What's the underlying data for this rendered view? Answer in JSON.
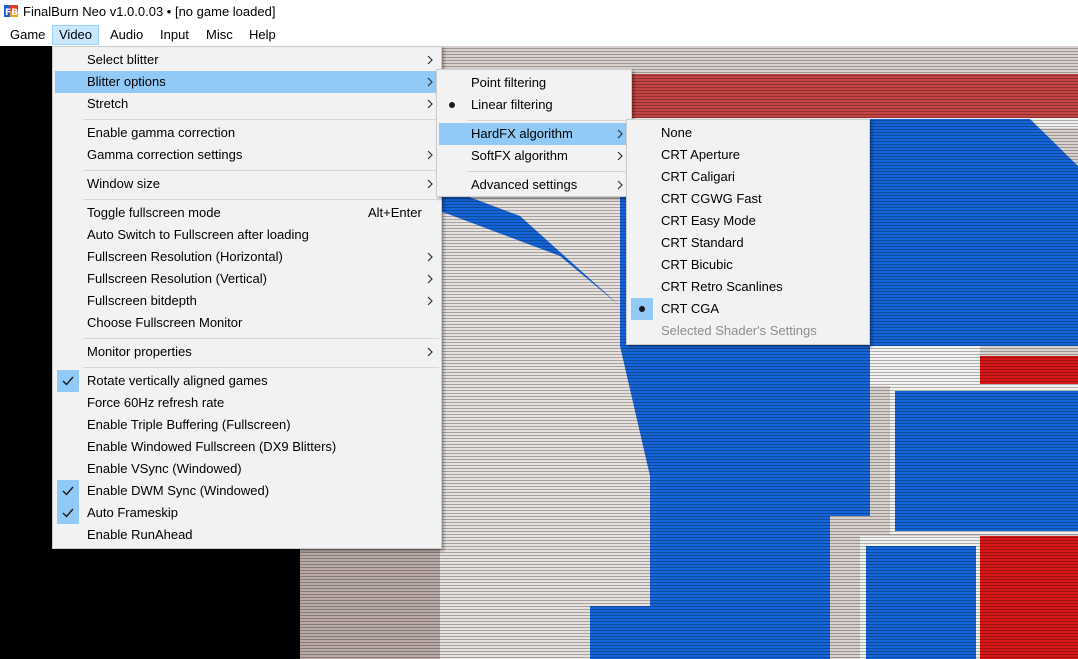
{
  "window": {
    "title": "FinalBurn Neo v1.0.0.03 • [no game loaded]",
    "icon": "fbneo-app-icon"
  },
  "menubar": {
    "items": [
      "Game",
      "Video",
      "Audio",
      "Input",
      "Misc",
      "Help"
    ],
    "active": "Video"
  },
  "video_menu": {
    "items": [
      {
        "label": "Select blitter",
        "submenu": true
      },
      {
        "label": "Blitter options",
        "submenu": true,
        "highlighted": true
      },
      {
        "label": "Stretch",
        "submenu": true
      },
      {
        "label": "Enable gamma correction"
      },
      {
        "label": "Gamma correction settings",
        "submenu": true
      },
      {
        "label": "Window size",
        "submenu": true
      },
      {
        "label": "Toggle fullscreen mode",
        "shortcut": "Alt+Enter"
      },
      {
        "label": "Auto Switch to Fullscreen after loading"
      },
      {
        "label": "Fullscreen Resolution (Horizontal)",
        "submenu": true
      },
      {
        "label": "Fullscreen Resolution (Vertical)",
        "submenu": true
      },
      {
        "label": "Fullscreen bitdepth",
        "submenu": true
      },
      {
        "label": "Choose Fullscreen Monitor"
      },
      {
        "label": "Monitor properties",
        "submenu": true
      },
      {
        "label": "Rotate vertically aligned games",
        "checked": true
      },
      {
        "label": "Force 60Hz refresh rate"
      },
      {
        "label": "Enable Triple Buffering (Fullscreen)"
      },
      {
        "label": "Enable Windowed Fullscreen (DX9 Blitters)"
      },
      {
        "label": "Enable VSync (Windowed)"
      },
      {
        "label": "Enable DWM Sync (Windowed)",
        "checked": true
      },
      {
        "label": "Auto Frameskip",
        "checked": true
      },
      {
        "label": "Enable RunAhead"
      }
    ]
  },
  "blitter_options_menu": {
    "items": [
      {
        "label": "Point filtering"
      },
      {
        "label": "Linear filtering",
        "radio": true
      },
      {
        "label": "HardFX algorithm",
        "submenu": true,
        "highlighted": true
      },
      {
        "label": "SoftFX algorithm",
        "submenu": true
      },
      {
        "label": "Advanced settings",
        "submenu": true
      }
    ]
  },
  "hardfx_menu": {
    "items": [
      {
        "label": "None"
      },
      {
        "label": "CRT Aperture"
      },
      {
        "label": "CRT Caligari"
      },
      {
        "label": "CRT CGWG Fast"
      },
      {
        "label": "CRT Easy Mode"
      },
      {
        "label": "CRT Standard"
      },
      {
        "label": "CRT Bicubic"
      },
      {
        "label": "CRT Retro Scanlines"
      },
      {
        "label": "CRT CGA",
        "radio": true
      },
      {
        "label": "Selected Shader's Settings",
        "disabled": true
      }
    ]
  },
  "colors": {
    "menu_bg": "#f2f2f2",
    "highlight": "#91c9f7",
    "menubar_active": "#cce8ff",
    "game_blue": "#1565d8",
    "game_red": "#d81818",
    "game_white": "#eaeaea"
  }
}
